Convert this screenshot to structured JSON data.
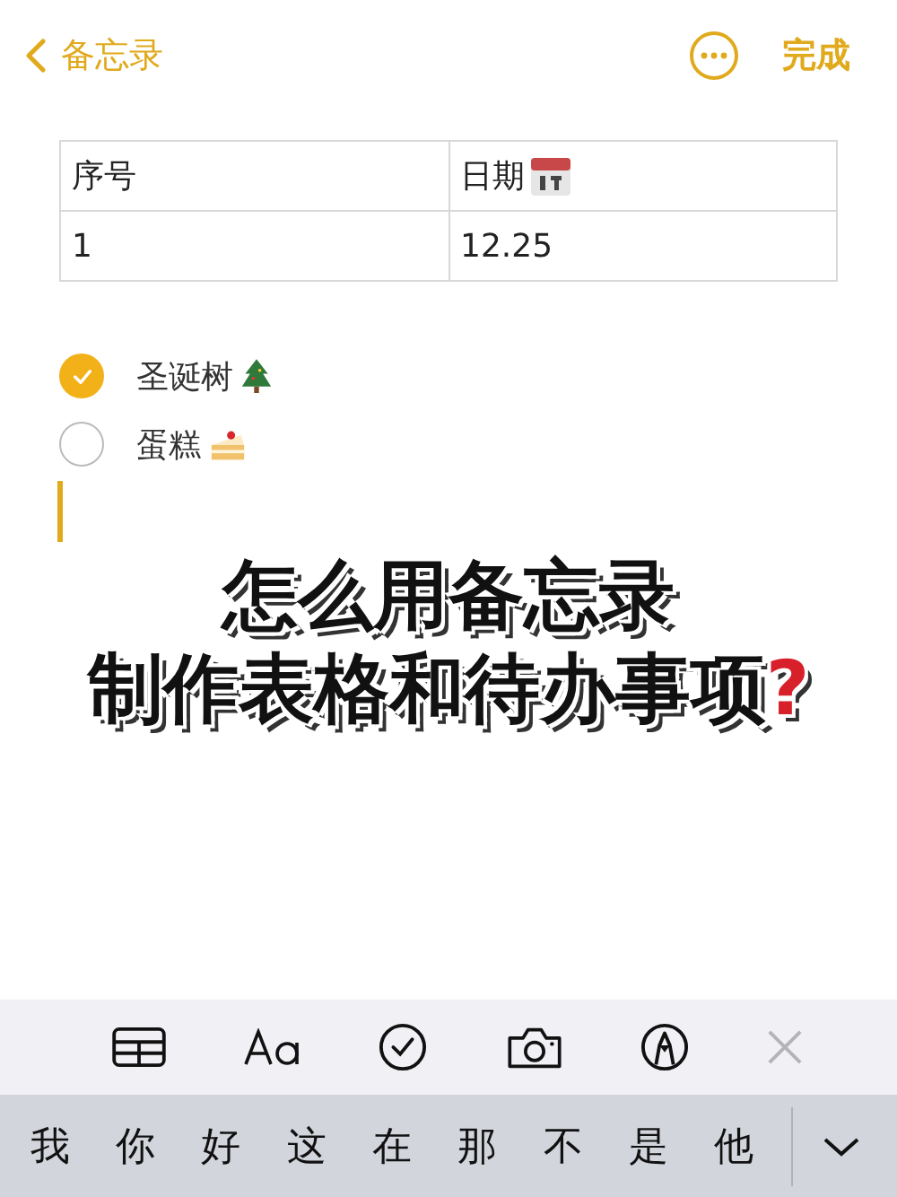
{
  "nav": {
    "back_label": "备忘录",
    "done_label": "完成"
  },
  "table": {
    "columns": [
      "序号",
      "日期"
    ],
    "rows": [
      [
        "1",
        "12.25"
      ]
    ]
  },
  "checklist": [
    {
      "text": "圣诞树",
      "checked": true
    },
    {
      "text": "蛋糕",
      "checked": false
    }
  ],
  "headline": {
    "lines": [
      "怎么用备忘录",
      "制作表格和待办事项"
    ],
    "mark": "?"
  },
  "candidates": [
    "我",
    "你",
    "好",
    "这",
    "在",
    "那",
    "不",
    "是",
    "他"
  ]
}
